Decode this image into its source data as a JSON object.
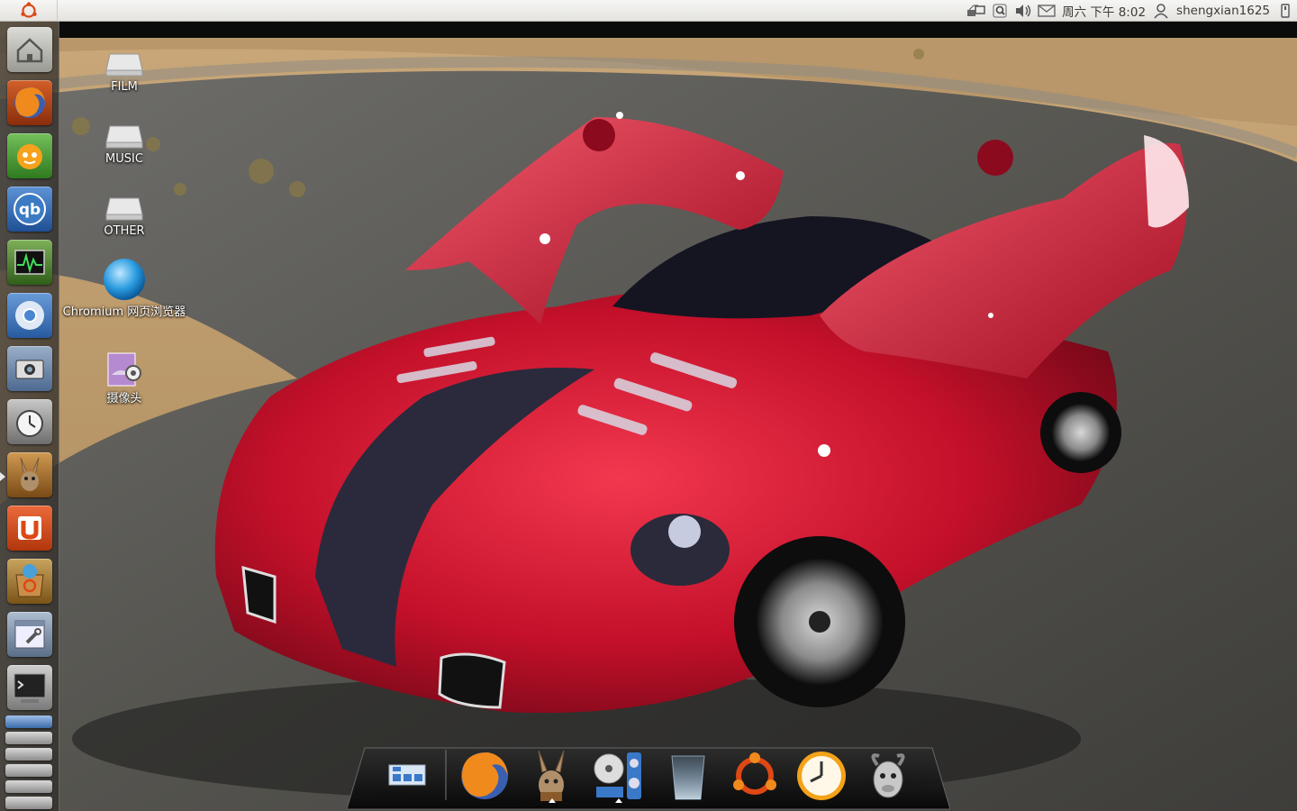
{
  "top_panel": {
    "clock": "周六 下午 8:02",
    "user": "shengxian1625",
    "icons": [
      "ubuntu-logo-icon",
      "network-icon",
      "search-icon",
      "volume-icon",
      "mail-icon",
      "user-icon",
      "power-icon"
    ]
  },
  "launcher": {
    "items": [
      {
        "name": "home-folder",
        "icon": "home-folder-icon"
      },
      {
        "name": "firefox",
        "icon": "firefox-icon"
      },
      {
        "name": "pps-player",
        "icon": "pps-player-icon"
      },
      {
        "name": "qbittorrent",
        "icon": "qbittorrent-icon"
      },
      {
        "name": "system-monitor",
        "icon": "system-monitor-icon"
      },
      {
        "name": "chromium",
        "icon": "chromium-icon"
      },
      {
        "name": "screenshot",
        "icon": "camera-screenshot-icon"
      },
      {
        "name": "time-backup",
        "icon": "clock-icon"
      },
      {
        "name": "amule",
        "icon": "amule-donkey-icon"
      },
      {
        "name": "ubuntu-one",
        "icon": "ubuntu-one-icon"
      },
      {
        "name": "software-center",
        "icon": "software-center-icon"
      },
      {
        "name": "system-settings",
        "icon": "settings-wrench-icon"
      },
      {
        "name": "terminal",
        "icon": "terminal-icon"
      }
    ],
    "colors": {
      "firefox": "#e66000",
      "pps": "#3a9b2a",
      "qbittorrent": "#3c7bc4",
      "ubuntu_one": "#dd4814"
    }
  },
  "desktop": {
    "icons": [
      {
        "label": "FILM",
        "icon": "drive-icon"
      },
      {
        "label": "MUSIC",
        "icon": "drive-icon"
      },
      {
        "label": "OTHER",
        "icon": "drive-icon"
      },
      {
        "label": "Chromium 网页浏览器",
        "icon": "chromium-globe-icon"
      },
      {
        "label": "摄像头",
        "icon": "webcam-icon"
      }
    ]
  },
  "dock": {
    "items": [
      {
        "name": "show-desktop",
        "icon": "desktop-grid-icon"
      },
      {
        "name": "firefox",
        "icon": "firefox-icon"
      },
      {
        "name": "amule",
        "icon": "amule-donkey-icon"
      },
      {
        "name": "media-player",
        "icon": "media-player-icon"
      },
      {
        "name": "trash",
        "icon": "trash-glass-icon"
      },
      {
        "name": "ubuntu",
        "icon": "ubuntu-logo-icon"
      },
      {
        "name": "clock",
        "icon": "clock-icon"
      },
      {
        "name": "gnome-goat",
        "icon": "goat-icon"
      }
    ]
  },
  "wallpaper": {
    "subject": "red sports car with gull-wing doors",
    "car_color": "#c8102e"
  }
}
